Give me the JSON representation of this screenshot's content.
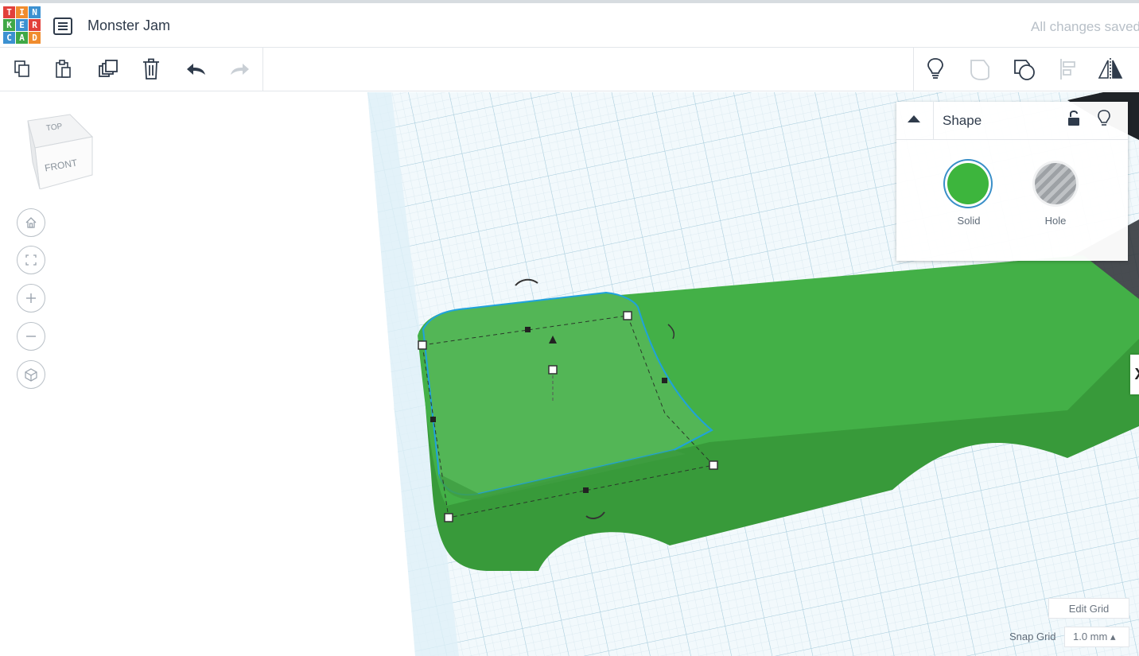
{
  "app": {
    "logo_letters": [
      "T",
      "I",
      "N",
      "K",
      "E",
      "R",
      "C",
      "A",
      "D"
    ],
    "logo_colors": [
      "#e2403b",
      "#f08c2e",
      "#3c91d1",
      "#3fa846",
      "#3c91d1",
      "#e2403b",
      "#3c91d1",
      "#3fa846",
      "#f08c2e"
    ],
    "title": "Monster Jam",
    "save_status": "All changes saved"
  },
  "toolbar": {
    "left_tools": [
      "copy-icon",
      "paste-icon",
      "duplicate-icon",
      "delete-icon",
      "undo-icon",
      "redo-icon"
    ],
    "right_tools": [
      "lightbulb-icon",
      "group-icon",
      "ungroup-icon",
      "align-icon",
      "mirror-icon"
    ]
  },
  "view_cube": {
    "top": "TOP",
    "front": "FRONT"
  },
  "nav_controls": [
    "home-view-icon",
    "fit-view-icon",
    "zoom-in-icon",
    "zoom-out-icon",
    "ortho-view-icon"
  ],
  "shape_panel": {
    "title": "Shape",
    "solid_label": "Solid",
    "hole_label": "Hole",
    "solid_color": "#3db53d"
  },
  "grid": {
    "edit_label": "Edit Grid",
    "snap_label": "Snap Grid",
    "snap_value": "1.0 mm ▴"
  },
  "colors": {
    "accent_green": "#3fa846",
    "grid_line": "#c5dbe6",
    "selection_outline": "#2aa7e0"
  }
}
